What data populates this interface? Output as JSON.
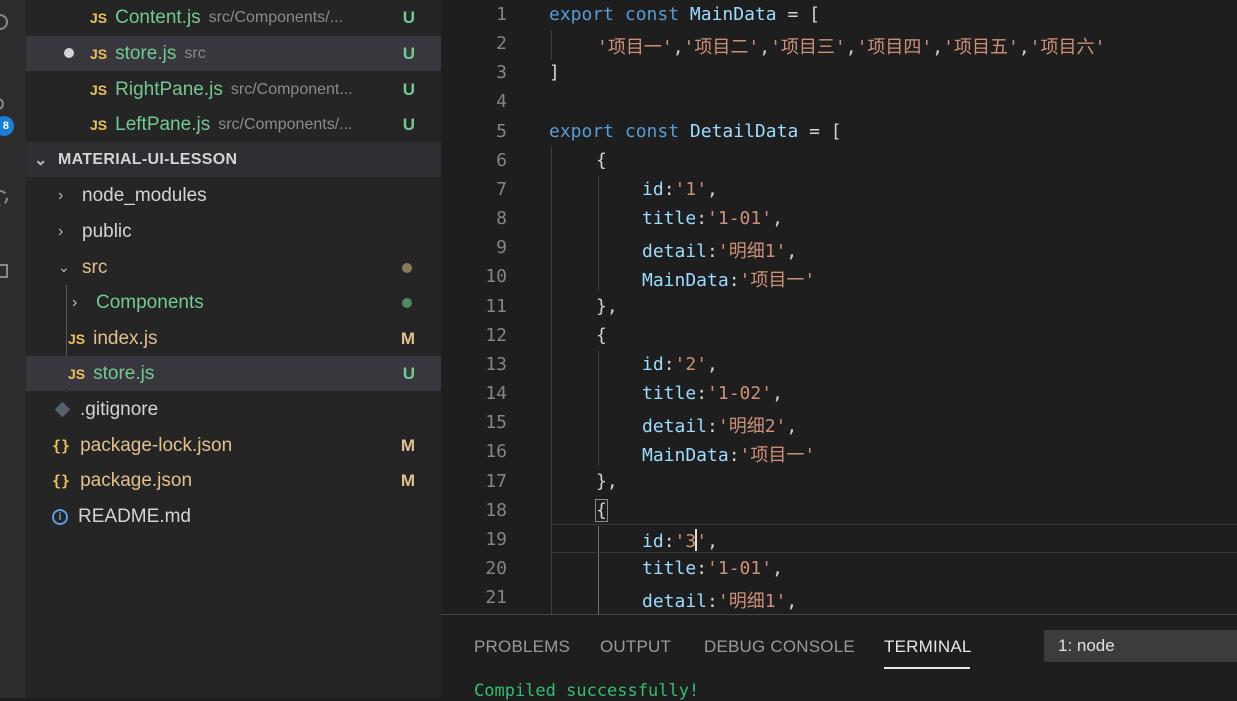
{
  "explorer": {
    "open_editors": [
      {
        "name": "Content.js",
        "path": "src/Components/...",
        "status": "U"
      },
      {
        "name": "store.js",
        "path": "src",
        "status": "U"
      },
      {
        "name": "RightPane.js",
        "path": "src/Component...",
        "status": "U"
      },
      {
        "name": "LeftPane.js",
        "path": "src/Components/...",
        "status": "U"
      }
    ],
    "project_title": "MATERIAL-UI-LESSON",
    "tree": [
      {
        "name": "node_modules"
      },
      {
        "name": "public"
      },
      {
        "name": "src"
      },
      {
        "name": "Components"
      },
      {
        "name": "index.js",
        "status": "M"
      },
      {
        "name": "store.js",
        "status": "U"
      },
      {
        "name": ".gitignore"
      },
      {
        "name": "package-lock.json",
        "status": "M"
      },
      {
        "name": "package.json",
        "status": "M"
      },
      {
        "name": "README.md"
      }
    ]
  },
  "activity": {
    "badge": "8"
  },
  "icons": {
    "js": "JS",
    "json": "{}",
    "info": "i"
  },
  "editor": {
    "line_numbers": [
      "1",
      "2",
      "3",
      "4",
      "5",
      "6",
      "7",
      "8",
      "9",
      "10",
      "11",
      "12",
      "13",
      "14",
      "15",
      "16",
      "17",
      "18",
      "19",
      "20",
      "21"
    ],
    "code": {
      "l1": {
        "kw": "export",
        "kw2": "const",
        "id": "MainData",
        "rest": " = ["
      },
      "l2": {
        "s1": "'项目一'",
        "s2": "'项目二'",
        "s3": "'项目三'",
        "s4": "'项目四'",
        "s5": "'项目五'",
        "s6": "'项目六'"
      },
      "l3": "]",
      "l5": {
        "kw": "export",
        "kw2": "const",
        "id": "DetailData",
        "rest": " = ["
      },
      "l6": "{",
      "l7": {
        "k": "id",
        "v": "'1'"
      },
      "l8": {
        "k": "title",
        "v": "'1-01'"
      },
      "l9": {
        "k": "detail",
        "v": "'明细1'"
      },
      "l10": {
        "k": "MainData",
        "v": "'项目一'"
      },
      "l11": "},",
      "l12": "{",
      "l13": {
        "k": "id",
        "v": "'2'"
      },
      "l14": {
        "k": "title",
        "v": "'1-02'"
      },
      "l15": {
        "k": "detail",
        "v": "'明细2'"
      },
      "l16": {
        "k": "MainData",
        "v": "'项目一'"
      },
      "l17": "},",
      "l18": "{",
      "l19": {
        "k": "id",
        "v_pre": "'3",
        "v_post": "'"
      },
      "l20": {
        "k": "title",
        "v": "'1-01'"
      },
      "l21": {
        "k": "detail",
        "v": "'明细1'"
      }
    }
  },
  "panel": {
    "tabs": [
      "PROBLEMS",
      "OUTPUT",
      "DEBUG CONSOLE",
      "TERMINAL"
    ],
    "active_tab": "TERMINAL",
    "terminal_select": "1: node",
    "terminal_output": "Compiled successfully!"
  },
  "colors": {
    "keyword": "#569cd6",
    "identifier": "#9cdcfe",
    "string": "#ce9178",
    "untracked": "#73c991",
    "modified": "#e2c08d"
  }
}
